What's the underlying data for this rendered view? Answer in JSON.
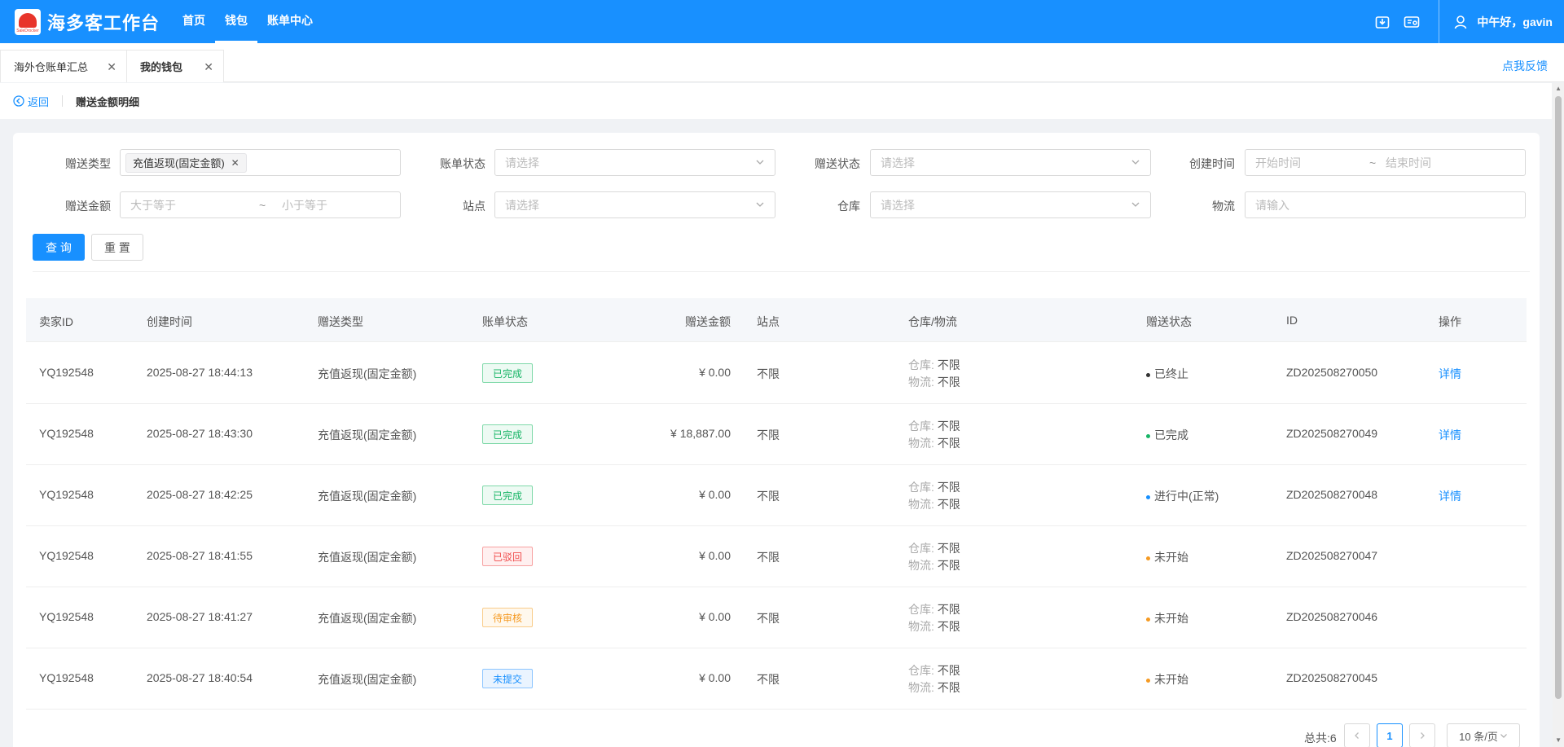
{
  "app": {
    "logo_sub": "SaleDrocker",
    "title": "海多客工作台",
    "nav": [
      "首页",
      "钱包",
      "账单中心"
    ],
    "greeting": "中午好，gavin"
  },
  "tabs": [
    {
      "label": "海外仓账单汇总"
    },
    {
      "label": "我的钱包"
    }
  ],
  "feedback": "点我反馈",
  "breadcrumb": {
    "back": "返回",
    "title": "赠送金额明细"
  },
  "filters": {
    "gift_type_label": "赠送类型",
    "gift_type_tag": "充值返现(固定金额)",
    "bill_status_label": "账单状态",
    "bill_status_placeholder": "请选择",
    "gift_status_label": "赠送状态",
    "gift_status_placeholder": "请选择",
    "created_label": "创建时间",
    "created_start": "开始时间",
    "created_sep": "~",
    "created_end": "结束时间",
    "amount_label": "赠送金额",
    "amount_min": "大于等于",
    "amount_sep": "~",
    "amount_max": "小于等于",
    "site_label": "站点",
    "site_placeholder": "请选择",
    "warehouse_label": "仓库",
    "warehouse_placeholder": "请选择",
    "logistics_label": "物流",
    "logistics_placeholder": "请输入",
    "query_btn": "查 询",
    "reset_btn": "重 置"
  },
  "table": {
    "headers": [
      "卖家ID",
      "创建时间",
      "赠送类型",
      "账单状态",
      "赠送金额",
      "站点",
      "仓库/物流",
      "赠送状态",
      "ID",
      "操作"
    ],
    "wh_key": "仓库:",
    "lg_key": "物流:",
    "rows": [
      {
        "seller": "YQ192548",
        "time": "2025-08-27 18:44:13",
        "type": "充值返现(固定金额)",
        "bill": "已完成",
        "bill_style": "green",
        "amount": "¥ 0.00",
        "site": "不限",
        "warehouse": "不限",
        "logistics": "不限",
        "gift_status": "已终止",
        "dot_color": "#333333",
        "id": "ZD202508270050",
        "op": "详情"
      },
      {
        "seller": "YQ192548",
        "time": "2025-08-27 18:43:30",
        "type": "充值返现(固定金额)",
        "bill": "已完成",
        "bill_style": "green",
        "amount": "¥ 18,887.00",
        "site": "不限",
        "warehouse": "不限",
        "logistics": "不限",
        "gift_status": "已完成",
        "dot_color": "#18b566",
        "id": "ZD202508270049",
        "op": "详情"
      },
      {
        "seller": "YQ192548",
        "time": "2025-08-27 18:42:25",
        "type": "充值返现(固定金额)",
        "bill": "已完成",
        "bill_style": "green",
        "amount": "¥ 0.00",
        "site": "不限",
        "warehouse": "不限",
        "logistics": "不限",
        "gift_status": "进行中(正常)",
        "dot_color": "#1890ff",
        "id": "ZD202508270048",
        "op": "详情"
      },
      {
        "seller": "YQ192548",
        "time": "2025-08-27 18:41:55",
        "type": "充值返现(固定金额)",
        "bill": "已驳回",
        "bill_style": "red",
        "amount": "¥ 0.00",
        "site": "不限",
        "warehouse": "不限",
        "logistics": "不限",
        "gift_status": "未开始",
        "dot_color": "#f59a23",
        "id": "ZD202508270047",
        "op": ""
      },
      {
        "seller": "YQ192548",
        "time": "2025-08-27 18:41:27",
        "type": "充值返现(固定金额)",
        "bill": "待审核",
        "bill_style": "orange",
        "amount": "¥ 0.00",
        "site": "不限",
        "warehouse": "不限",
        "logistics": "不限",
        "gift_status": "未开始",
        "dot_color": "#f59a23",
        "id": "ZD202508270046",
        "op": ""
      },
      {
        "seller": "YQ192548",
        "time": "2025-08-27 18:40:54",
        "type": "充值返现(固定金额)",
        "bill": "未提交",
        "bill_style": "blue",
        "amount": "¥ 0.00",
        "site": "不限",
        "warehouse": "不限",
        "logistics": "不限",
        "gift_status": "未开始",
        "dot_color": "#f59a23",
        "id": "ZD202508270045",
        "op": ""
      }
    ]
  },
  "pagination": {
    "total": "总共:6",
    "current_page": "1",
    "page_size": "10 条/页"
  },
  "colors": {
    "primary": "#1890ff"
  }
}
